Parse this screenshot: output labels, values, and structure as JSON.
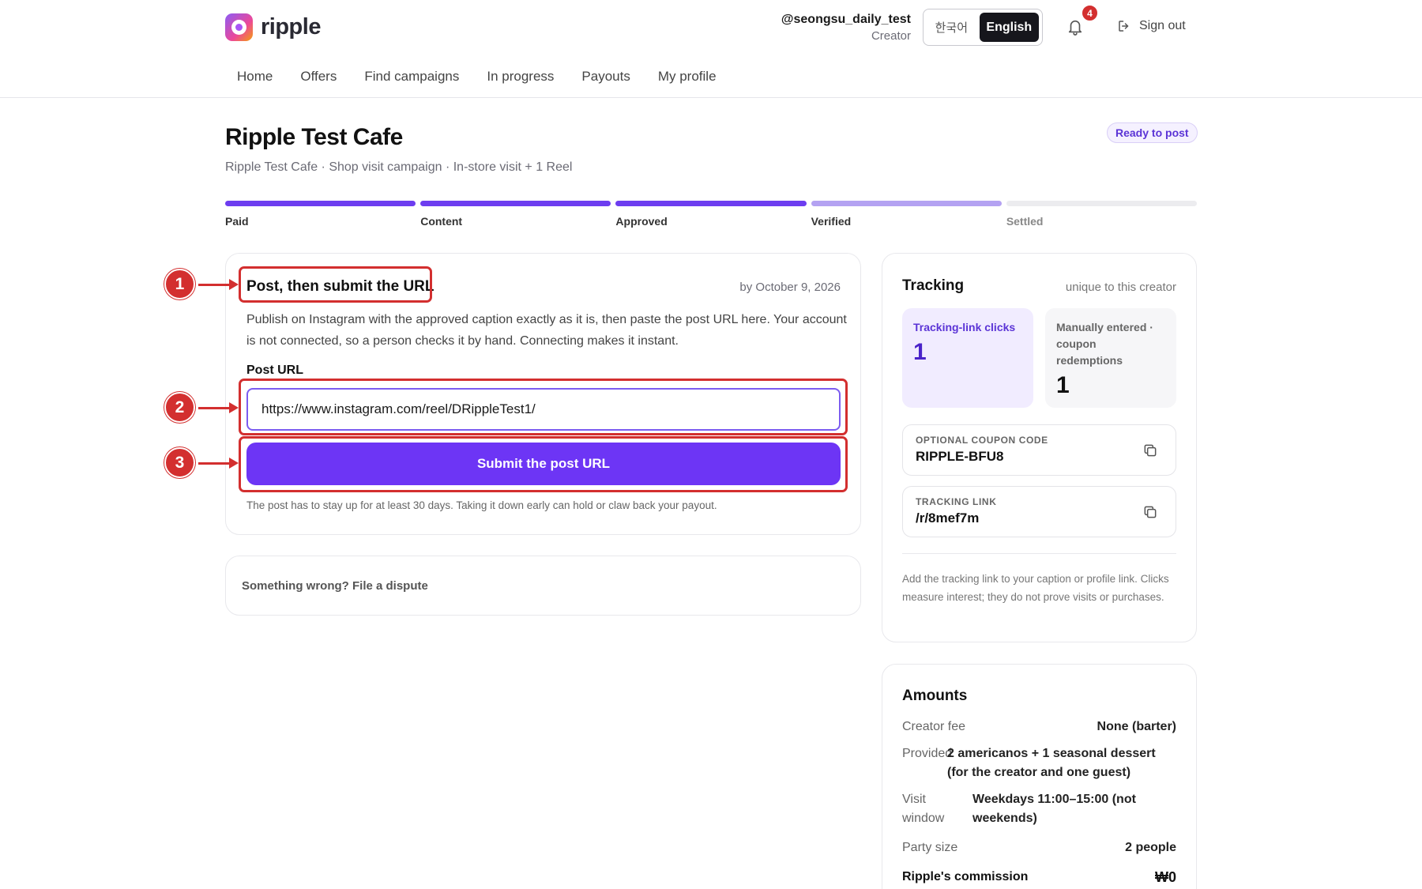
{
  "app": {
    "brand": "ripple",
    "user_handle": "@seongsu_daily_test",
    "user_role": "Creator",
    "lang_ko": "한국어",
    "lang_en": "English",
    "notif_count": "4",
    "sign_out": "Sign out",
    "nav": [
      "Home",
      "Offers",
      "Find campaigns",
      "In progress",
      "Payouts",
      "My profile"
    ]
  },
  "campaign": {
    "title": "Ripple Test Cafe",
    "subtitle": "Ripple Test Cafe · Shop visit campaign · In-store visit + 1 Reel",
    "status": "Ready to post",
    "steps": [
      "Paid",
      "Content",
      "Approved",
      "Verified",
      "Settled"
    ]
  },
  "submit": {
    "heading": "Post, then submit the URL",
    "deadline": "by October 9, 2026",
    "description": "Publish on Instagram with the approved caption exactly as it is, then paste the post URL here. Your account is not connected, so a person checks it by hand. Connecting makes it instant.",
    "field_label": "Post URL",
    "url_value": "https://www.instagram.com/reel/DRippleTest1/",
    "button_label": "Submit the post URL",
    "note": "The post has to stay up for at least 30 days. Taking it down early can hold or claw back your payout."
  },
  "dispute": {
    "label": "Something wrong? File a dispute"
  },
  "tracking": {
    "title": "Tracking",
    "subtitle": "unique to this creator",
    "clicks_label": "Tracking-link clicks",
    "clicks_value": "1",
    "coupon_label": "Manually entered · coupon redemptions",
    "coupon_value": "1",
    "coupon_code_label": "OPTIONAL COUPON CODE",
    "coupon_code": "RIPPLE-BFU8",
    "link_label": "TRACKING LINK",
    "link_value": "/r/8mef7m",
    "help": "Add the tracking link to your caption or profile link. Clicks measure interest; they do not prove visits or purchases."
  },
  "amounts": {
    "title": "Amounts",
    "creator_fee_key": "Creator fee",
    "creator_fee_val": "None (barter)",
    "provided_key": "Provided",
    "provided_val": "2 americanos + 1 seasonal dessert (for the creator and one guest)",
    "visit_key": "Visit window",
    "visit_val": "Weekdays 11:00–15:00 (not weekends)",
    "party_key": "Party size",
    "party_val": "2 people",
    "commission_key": "Ripple's commission",
    "commission_val": "₩0"
  },
  "annotations": [
    "1",
    "2",
    "3"
  ],
  "colors": {
    "accent": "#6d35f5",
    "annotation": "#d32f2f"
  }
}
